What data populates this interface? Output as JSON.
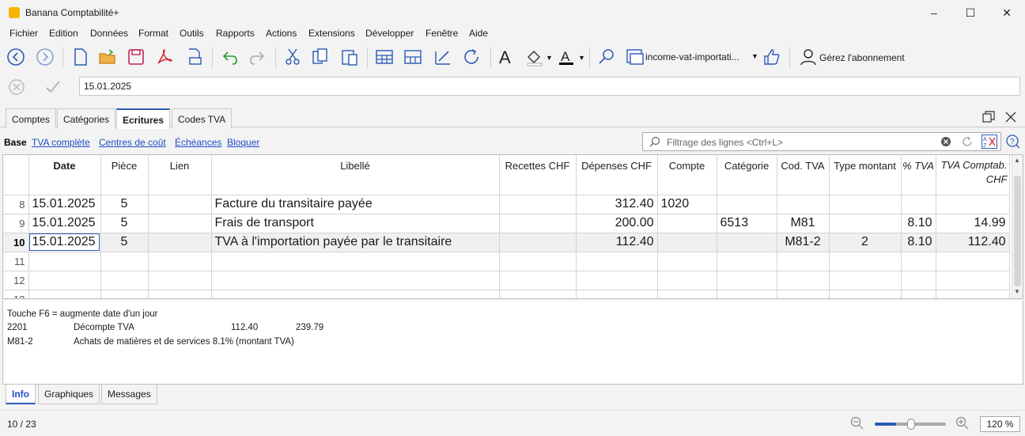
{
  "app": {
    "title": "Banana Comptabilité+"
  },
  "menu": [
    "Fichier",
    "Edition",
    "Données",
    "Format",
    "Outils",
    "Rapports",
    "Actions",
    "Extensions",
    "Développer",
    "Fenêtre",
    "Aide"
  ],
  "toolbar": {
    "icons": [
      "back-icon",
      "forward-icon",
      "new-file-icon",
      "open-folder-icon",
      "save-icon",
      "pdf-icon",
      "print-preview-icon",
      "undo-icon",
      "redo-icon",
      "cut-icon",
      "copy-icon",
      "paste-icon",
      "insert-row-icon",
      "add-rows-icon",
      "edit-cell-icon",
      "recalculate-icon",
      "font-icon",
      "fill-color-icon",
      "text-color-icon",
      "search-icon",
      "file-tab-icon",
      "thumbs-up-icon",
      "user-icon"
    ],
    "file_selector": "income-vat-importati...",
    "subscription_label": "Gérez l'abonnement",
    "accent_color": "#2b5ab4"
  },
  "edit": {
    "value": "15.01.2025"
  },
  "tabs": [
    {
      "label": "Comptes",
      "active": false
    },
    {
      "label": "Catégories",
      "active": false
    },
    {
      "label": "Ecritures",
      "active": true
    },
    {
      "label": "Codes TVA",
      "active": false
    }
  ],
  "views": {
    "base": "Base",
    "links": [
      "TVA complète",
      "Centres de coût",
      "Échéances",
      "Bloquer"
    ]
  },
  "filter": {
    "placeholder": "Filtrage des lignes <Ctrl+L>"
  },
  "table": {
    "headers": [
      "Date",
      "Pièce",
      "Lien",
      "Libellé",
      "Recettes CHF",
      "Dépenses CHF",
      "Compte",
      "Catégorie",
      "Cod. TVA",
      "Type montant",
      "% TVA",
      "TVA Comptab. CHF"
    ],
    "rows": [
      {
        "n": "8",
        "date": "15.01.2025",
        "piece": "5",
        "lien": "",
        "libelle": "Facture du transitaire payée",
        "recettes": "",
        "depenses": "312.40",
        "compte": "1020",
        "categorie": "",
        "codtva": "",
        "type": "",
        "pct": "",
        "tvacompt": ""
      },
      {
        "n": "9",
        "date": "15.01.2025",
        "piece": "5",
        "lien": "",
        "libelle": "Frais de transport",
        "recettes": "",
        "depenses": "200.00",
        "compte": "",
        "categorie": "6513",
        "codtva": "M81",
        "type": "",
        "pct": "8.10",
        "tvacompt": "14.99"
      },
      {
        "n": "10",
        "date": "15.01.2025",
        "piece": "5",
        "lien": "",
        "libelle": "TVA à l'importation payée par le transitaire",
        "recettes": "",
        "depenses": "112.40",
        "compte": "",
        "categorie": "",
        "codtva": "M81-2",
        "type": "2",
        "pct": "8.10",
        "tvacompt": "112.40"
      },
      {
        "n": "11",
        "date": "",
        "piece": "",
        "lien": "",
        "libelle": "",
        "recettes": "",
        "depenses": "",
        "compte": "",
        "categorie": "",
        "codtva": "",
        "type": "",
        "pct": "",
        "tvacompt": ""
      },
      {
        "n": "12",
        "date": "",
        "piece": "",
        "lien": "",
        "libelle": "",
        "recettes": "",
        "depenses": "",
        "compte": "",
        "categorie": "",
        "codtva": "",
        "type": "",
        "pct": "",
        "tvacompt": ""
      },
      {
        "n": "13",
        "date": "",
        "piece": "",
        "lien": "",
        "libelle": "",
        "recettes": "",
        "depenses": "",
        "compte": "",
        "categorie": "",
        "codtva": "",
        "type": "",
        "pct": "",
        "tvacompt": ""
      }
    ]
  },
  "info": {
    "hint": "Touche F6 = augmente date d'un jour",
    "lines": [
      {
        "code": "2201",
        "desc": "Décompte TVA",
        "v1": "112.40",
        "v2": "239.79"
      },
      {
        "code": "M81-2",
        "desc": "Achats de matières et de services 8.1% (montant TVA)",
        "v1": "",
        "v2": ""
      }
    ]
  },
  "bottom_tabs": [
    {
      "label": "Info",
      "active": true
    },
    {
      "label": "Graphiques",
      "active": false
    },
    {
      "label": "Messages",
      "active": false
    }
  ],
  "status": {
    "position": "10 / 23",
    "zoom": "120 %",
    "zoom_level": 0.3
  }
}
